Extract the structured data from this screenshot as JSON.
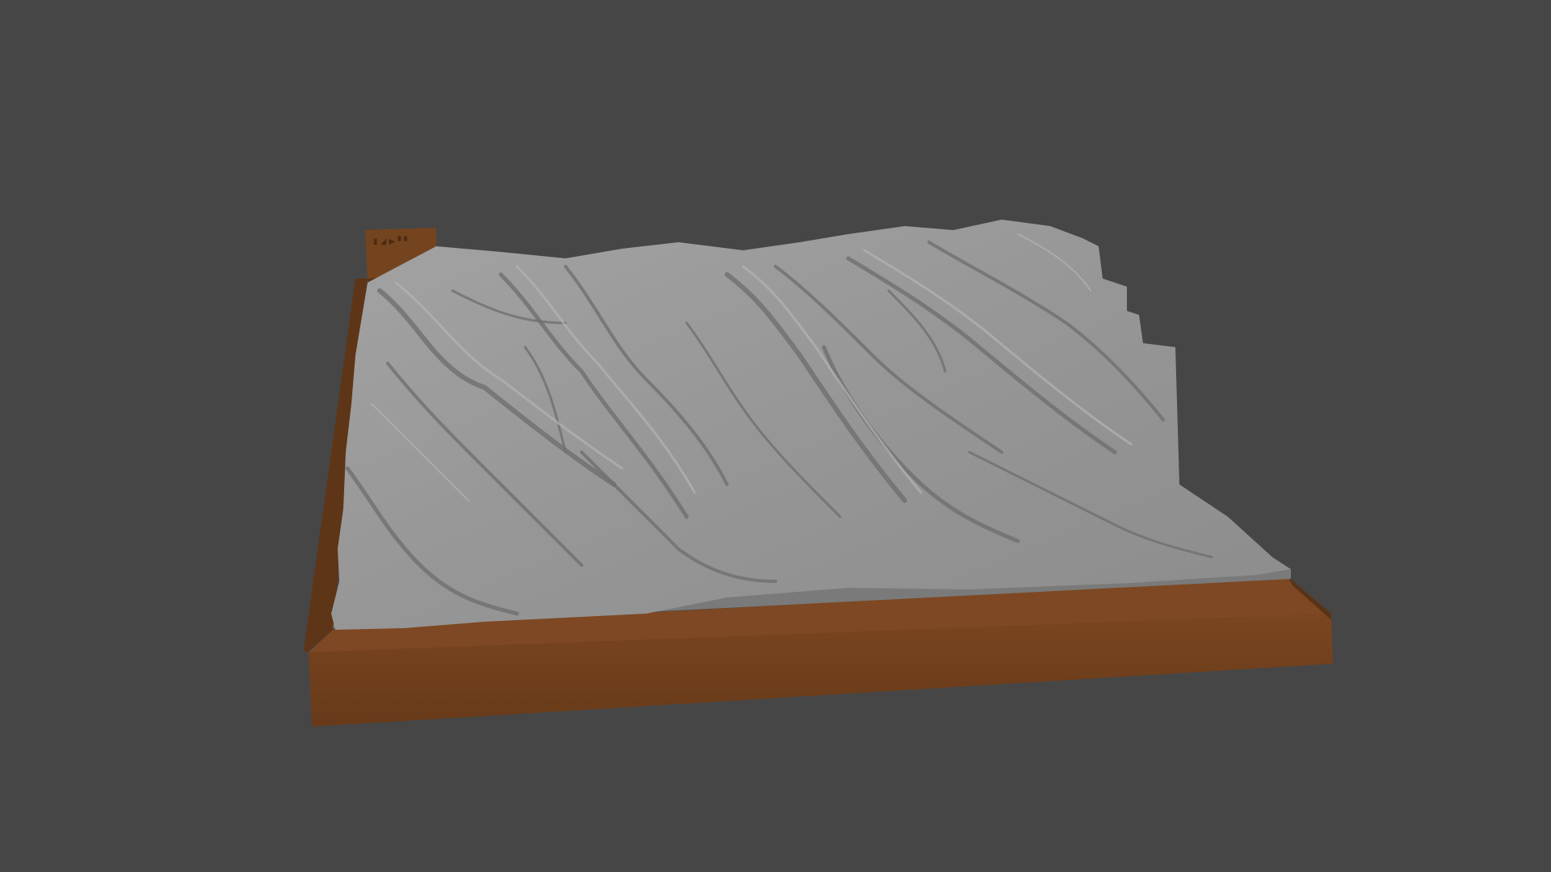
{
  "viewport": {
    "background_color": "#464646",
    "object": {
      "description_name": "terrain-relief-model",
      "terrain_color": "#9a9a9a",
      "terrain_shadow_color": "#6f6f6f",
      "base_color": "#6e3f1c",
      "base_top_color": "#7a4621",
      "tag_block_color": "#74441f"
    }
  }
}
